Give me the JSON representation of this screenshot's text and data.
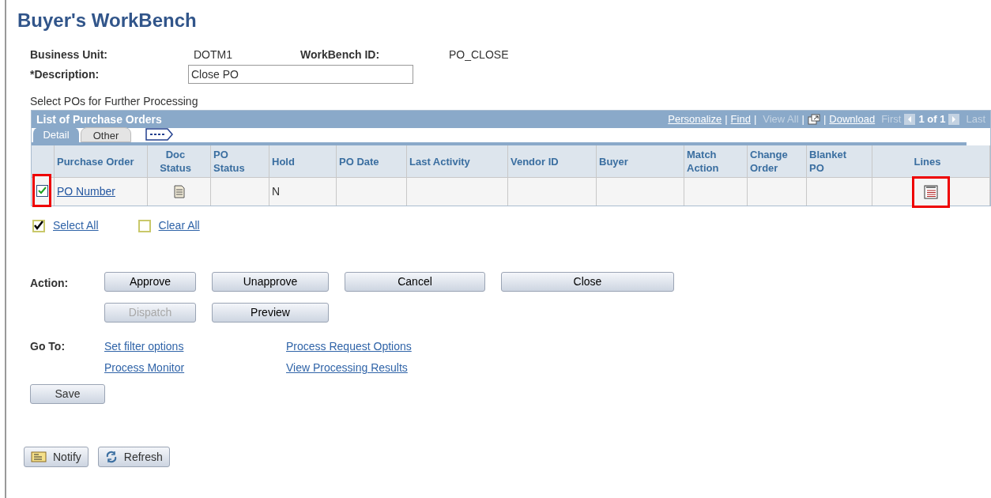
{
  "title": "Buyer's WorkBench",
  "fields": [
    {
      "label": "Business Unit:",
      "value": "DOTM1"
    },
    {
      "label": "WorkBench ID:",
      "value": "PO_CLOSE"
    }
  ],
  "description": {
    "label": "*Description:",
    "value": "Close PO"
  },
  "section_label": "Select POs for Further Processing",
  "grid": {
    "title": "List of Purchase Orders",
    "nav": [
      {
        "text": "Personalize",
        "kind": "link"
      },
      {
        "text": "|",
        "kind": "sep"
      },
      {
        "text": "Find",
        "kind": "link"
      },
      {
        "text": "|",
        "kind": "sep"
      },
      {
        "text": "View All",
        "kind": "dim"
      },
      {
        "text": "|",
        "kind": "sep"
      },
      {
        "kind": "popout"
      },
      {
        "text": "|",
        "kind": "sep"
      },
      {
        "text": "Download",
        "kind": "link"
      },
      {
        "text": "First",
        "kind": "dim"
      },
      {
        "kind": "prev"
      },
      {
        "text": "1 of 1",
        "kind": "bold"
      },
      {
        "kind": "next"
      },
      {
        "text": "Last",
        "kind": "dim"
      }
    ],
    "tabs": [
      {
        "label": "Detail",
        "selected": true
      },
      {
        "label": "Other",
        "selected": false
      }
    ],
    "columns": [
      "",
      "Purchase Order",
      "Doc Status",
      "PO Status",
      "Hold",
      "PO Date",
      "Last Activity",
      "Vendor ID",
      "Buyer",
      "Match Action",
      "Change Order",
      "Blanket PO",
      "Lines"
    ],
    "rows": [
      {
        "checked": true,
        "po_number": "PO Number",
        "hold": "N"
      }
    ]
  },
  "select_all": "Select All",
  "clear_all": "Clear All",
  "action_label": "Action:",
  "actions": [
    [
      {
        "label": "Approve",
        "disabled": false
      },
      {
        "label": "Unapprove",
        "disabled": false
      },
      {
        "label": "Cancel",
        "disabled": false
      },
      {
        "label": "Close",
        "disabled": false
      }
    ],
    [
      {
        "label": "Dispatch",
        "disabled": true
      },
      {
        "label": "Preview",
        "disabled": false
      }
    ]
  ],
  "goto_label": "Go To:",
  "goto_links": [
    [
      "Set filter options",
      "Process Monitor"
    ],
    [
      "Process Request Options",
      "View Processing Results"
    ]
  ],
  "save": "Save",
  "footer": [
    {
      "label": "Notify",
      "kind": "notify"
    },
    {
      "label": "Refresh",
      "kind": "refresh"
    }
  ]
}
